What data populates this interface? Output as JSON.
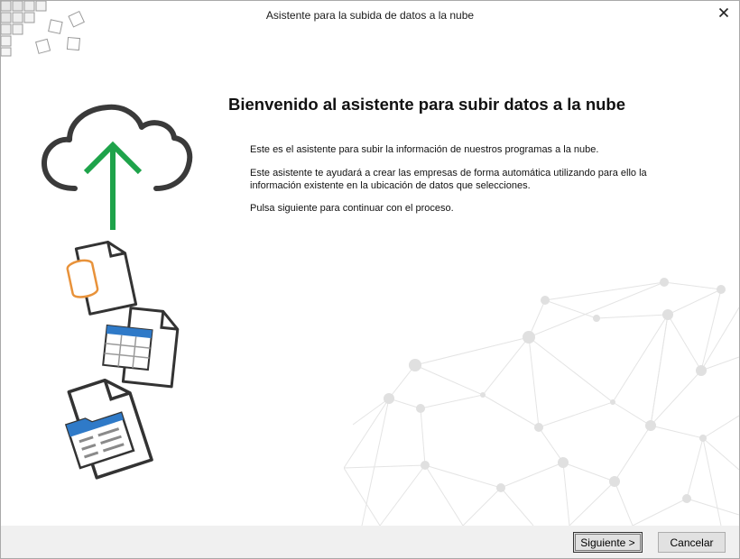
{
  "window": {
    "title": "Asistente para la subida de datos a la nube",
    "close_glyph": "✕"
  },
  "content": {
    "heading": "Bienvenido al asistente para subir datos a la nube",
    "paragraphs": [
      "Este es el asistente para subir la información de nuestros programas a la nube.",
      "Este asistente te ayudará a crear las empresas de forma automática utilizando para ello la información existente en la ubicación de datos que selecciones.",
      "Pulsa siguiente para continuar con el proceso."
    ]
  },
  "illustration": {
    "icons": [
      "cloud-upload-icon",
      "database-document-icon",
      "spreadsheet-document-icon",
      "folder-document-icon"
    ],
    "colors": {
      "arrow": "#1ea34a",
      "database": "#e8923a",
      "table_header": "#2f7ac8",
      "stroke": "#333333"
    }
  },
  "footer": {
    "next_label": "Siguiente >",
    "cancel_label": "Cancelar"
  }
}
